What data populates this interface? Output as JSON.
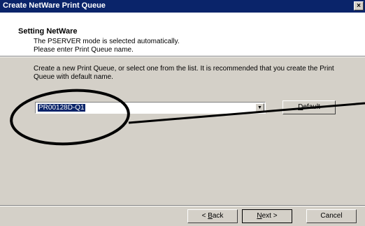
{
  "window": {
    "title": "Create NetWare Print Queue",
    "close_label": "×"
  },
  "header": {
    "title": "Setting NetWare",
    "line1": "The PSERVER mode is selected automatically.",
    "line2": "Please enter Print Queue name."
  },
  "main": {
    "instruction": "Create a new Print Queue, or select one from the list. It is recommended that you create the Print Queue with default name.",
    "queue_combo": {
      "value": "PR00128D-Q1",
      "arrow": "▼"
    },
    "default_button": {
      "label_u": "D",
      "label_rest": "efault"
    }
  },
  "footer": {
    "back_button": {
      "prefix": "< ",
      "label_u": "B",
      "label_rest": "ack"
    },
    "next_button": {
      "label_u": "N",
      "label_rest": "ext >"
    },
    "cancel_button": {
      "label": "Cancel"
    }
  }
}
